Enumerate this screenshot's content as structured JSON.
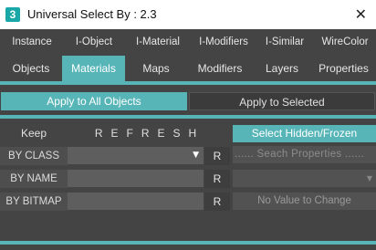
{
  "window": {
    "icon_char": "3",
    "title": "Universal Select By : 2.3",
    "close_glyph": "✕"
  },
  "tabs_row1": [
    "Instance",
    "I-Object",
    "I-Material",
    "I-Modifiers",
    "I-Similar",
    "WireColor"
  ],
  "tabs_row2": [
    "Objects",
    "Materials",
    "Maps",
    "Modifiers",
    "Layers",
    "Properties"
  ],
  "active_tab_row2": "Materials",
  "apply": {
    "all_label": "Apply to All Objects",
    "selected_label": "Apply to Selected"
  },
  "header": {
    "keep_label": "Keep",
    "refresh_label": "REFRESH",
    "hidden_label": "Select Hidden/Frozen"
  },
  "rows": {
    "by_class": {
      "label": "BY CLASS",
      "value": "",
      "r_label": "R",
      "right_placeholder": "...... Seach Properties ......"
    },
    "by_name": {
      "label": "BY NAME",
      "value": "",
      "r_label": "R",
      "right_value": ""
    },
    "by_bitmap": {
      "label": "BY BITMAP",
      "value": "",
      "r_label": "R",
      "right_text": "No Value to Change"
    }
  },
  "colors": {
    "accent": "#57b5b8",
    "background": "#444444"
  }
}
